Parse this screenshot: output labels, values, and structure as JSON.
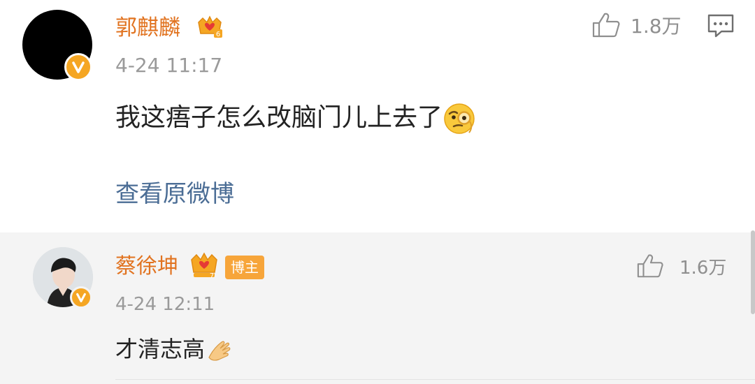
{
  "post": {
    "author": "郭麒麟",
    "author_level_badge": "6",
    "time": "4-24 11:17",
    "text": "我这痦子怎么改脑门儿上去了",
    "emoji": "monocle-face",
    "like_count": "1.8万",
    "view_original": "查看原微博"
  },
  "reply": {
    "author": "蔡徐坤",
    "author_level_badge": "7",
    "tag": "博主",
    "time": "4-24 12:11",
    "text": "才清志高",
    "emoji": "clap-hands",
    "like_count": "1.6万"
  },
  "colors": {
    "username": "#e17320",
    "link": "#4b6d95",
    "meta": "#9a9a9a",
    "badge": "#f5a623",
    "blogger_tag": "#f7a53a"
  },
  "icons": [
    "avatar",
    "verified-v-icon",
    "crown-badge-icon",
    "thumbs-up-icon",
    "comment-icon",
    "monocle-emoji",
    "clap-emoji"
  ]
}
